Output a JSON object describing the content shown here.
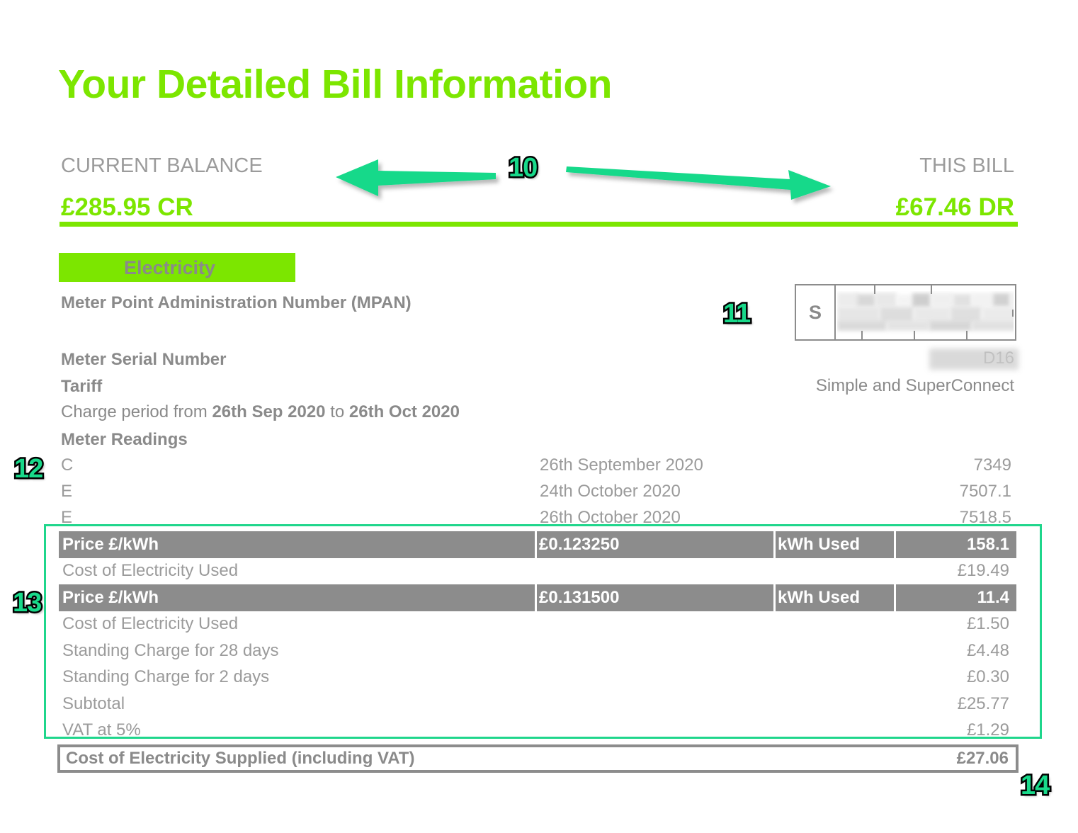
{
  "page": {
    "title": "Your Detailed Bill Information",
    "accent_green": "#7ce600",
    "annotation_green": "#18d98a",
    "grey_text": "#8a8a8a"
  },
  "balance": {
    "left_label": "CURRENT BALANCE",
    "left_amount": "£285.95 CR",
    "right_label": "THIS BILL",
    "right_amount": "£67.46 DR"
  },
  "fuel": {
    "band_label": "Electricity",
    "mpan_label": "Meter Point Administration Number (MPAN)",
    "mpan_prefix": "S",
    "meter_serial_label": "Meter Serial Number",
    "meter_serial_value": "D16",
    "tariff_label": "Tariff",
    "tariff_value": "Simple and SuperConnect",
    "charge_period_prefix": "Charge period from ",
    "charge_period_from": "26th Sep 2020",
    "charge_period_mid": " to ",
    "charge_period_to": "26th Oct 2020",
    "meter_readings_label": "Meter Readings"
  },
  "meter_readings": [
    {
      "type": "C",
      "date": "26th September 2020",
      "value": "7349"
    },
    {
      "type": "E",
      "date": "24th October 2020",
      "value": "7507.1"
    },
    {
      "type": "E",
      "date": "26th October 2020",
      "value": "7518.5"
    }
  ],
  "charges": [
    {
      "kind": "head",
      "label": "Price £/kWh",
      "price": "£0.123250",
      "kwh_label": "kWh Used",
      "kwh_value": "158.1"
    },
    {
      "kind": "plain",
      "label": "Cost of Electricity Used",
      "amount": "£19.49"
    },
    {
      "kind": "head",
      "label": "Price £/kWh",
      "price": "£0.131500",
      "kwh_label": "kWh Used",
      "kwh_value": "11.4"
    },
    {
      "kind": "plain",
      "label": "Cost of Electricity Used",
      "amount": "£1.50"
    },
    {
      "kind": "plain",
      "label": "Standing Charge for 28 days",
      "amount": "£4.48"
    },
    {
      "kind": "plain",
      "label": "Standing Charge for 2 days",
      "amount": "£0.30"
    },
    {
      "kind": "plain",
      "label": "Subtotal",
      "amount": "£25.77"
    },
    {
      "kind": "plain",
      "label": "VAT at 5%",
      "amount": "£1.29"
    }
  ],
  "total": {
    "label": "Cost of Electricity Supplied (including VAT)",
    "amount": "£27.06"
  },
  "annotations": {
    "a10": "10",
    "a11": "11",
    "a12": "12",
    "a13": "13",
    "a14": "14"
  }
}
